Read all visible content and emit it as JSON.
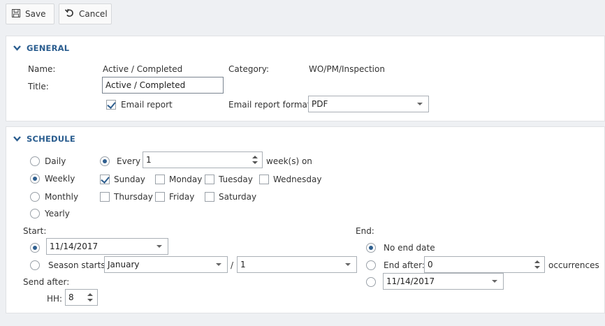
{
  "toolbar": {
    "save_label": "Save",
    "cancel_label": "Cancel",
    "save_icon": "floppy-disk-icon",
    "cancel_icon": "undo-icon"
  },
  "general": {
    "heading": "GENERAL",
    "name_label": "Name:",
    "name_value": "Active / Completed",
    "category_label": "Category:",
    "category_value": "WO/PM/Inspection",
    "title_label": "Title:",
    "title_value": "Active / Completed",
    "email_report_label": "Email report",
    "email_report_checked": true,
    "email_format_label": "Email report format:",
    "email_format_value": "PDF"
  },
  "schedule": {
    "heading": "SCHEDULE",
    "frequency_options": [
      {
        "label": "Daily",
        "selected": false
      },
      {
        "label": "Weekly",
        "selected": true
      },
      {
        "label": "Monthly",
        "selected": false
      },
      {
        "label": "Yearly",
        "selected": false
      }
    ],
    "every_label": "Every",
    "every_value": "1",
    "every_suffix": "week(s) on",
    "days": [
      {
        "label": "Sunday",
        "checked": true
      },
      {
        "label": "Monday",
        "checked": false
      },
      {
        "label": "Tuesday",
        "checked": false
      },
      {
        "label": "Wednesday",
        "checked": false
      },
      {
        "label": "Thursday",
        "checked": false
      },
      {
        "label": "Friday",
        "checked": false
      },
      {
        "label": "Saturday",
        "checked": false
      }
    ],
    "start_label": "Start:",
    "start_date": "11/14/2017",
    "season_starts_label": "Season starts:",
    "season_month": "January",
    "season_sep": "/",
    "season_day": "1",
    "send_after_label": "Send after:",
    "hh_label": "HH:",
    "hh_value": "8",
    "end_label": "End:",
    "no_end_date_label": "No end date",
    "end_after_label": "End after:",
    "end_after_value": "0",
    "occurrences_label": "occurrences",
    "end_date": "11/14/2017"
  },
  "colors": {
    "accent": "#2f5f8f",
    "heading": "#2a5d8f",
    "background": "#eef0f3"
  }
}
